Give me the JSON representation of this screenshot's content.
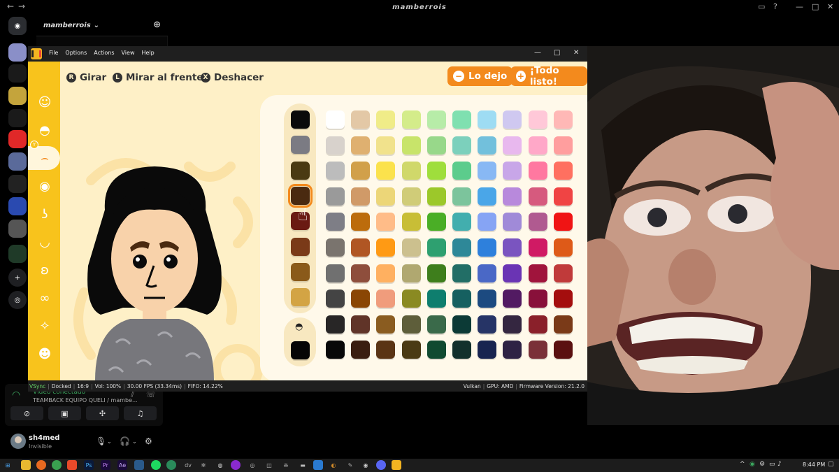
{
  "discord": {
    "window_title": "mamberrois",
    "server_name": "mamberrois",
    "voice": {
      "status": "Vídeo conectado",
      "channel": "TEAMBACK EQUIPO QUELI / mambe..."
    },
    "user": {
      "name": "sh4med",
      "status": "Invisible"
    }
  },
  "emulator": {
    "menu": [
      "File",
      "Options",
      "Actions",
      "View",
      "Help"
    ],
    "status": {
      "vsync": "VSync",
      "docked": "Docked",
      "aspect": "16:9",
      "vol": "Vol: 100%",
      "fps": "30.00 FPS (33.34ms)",
      "fifo": "FIFO: 14.22%",
      "api": "Vulkan",
      "gpu": "GPU: AMD",
      "firmware": "Firmware Version: 21.2.0"
    }
  },
  "game": {
    "rotate": "Girar",
    "face_front": "Mirar al frente",
    "undo": "Deshacer",
    "quit": "Lo dejo",
    "done": "¡Todo listo!",
    "rotate_glyph": "R",
    "face_glyph": "L",
    "undo_glyph": "X",
    "badge": "Y"
  },
  "palette": {
    "primary": [
      "#0a0a0a",
      "#7b7b83",
      "#4a3a12",
      "#4a2a10",
      "#6a1a12",
      "#7a3a18",
      "#8a5a1a",
      "#d3a444"
    ],
    "selected_index": 3,
    "hair_primary": "#050505",
    "rows": [
      [
        "#ffffff",
        "#e3c8a6",
        "#f0ec88",
        "#d4ec8a",
        "#b7eca8",
        "#7fe0b0",
        "#9edcf3",
        "#cfc8f0",
        "#ffc8d8",
        "#ffb8b6"
      ],
      [
        "#d8d2cc",
        "#dfb070",
        "#f1e28c",
        "#c8e46a",
        "#98d88a",
        "#7cd0bc",
        "#72c0dc",
        "#e8b8ee",
        "#ffa8c8",
        "#ff9e9e"
      ],
      [
        "#bcbcbc",
        "#d1a04a",
        "#fbe24c",
        "#d0d86a",
        "#9fde3c",
        "#5ccc8c",
        "#88b8f4",
        "#c8a6e8",
        "#ff78a0",
        "#ff7060"
      ],
      [
        "#9a9a9a",
        "#d09a68",
        "#ecd678",
        "#d0cc78",
        "#9cc82a",
        "#7cc49c",
        "#4aa6e8",
        "#b889dc",
        "#d65a7e",
        "#f04444"
      ],
      [
        "#7e7e86",
        "#bc6c0c",
        "#ffbc88",
        "#c8be36",
        "#4aae26",
        "#42aeae",
        "#86a4f4",
        "#a08ad8",
        "#b05a90",
        "#f01414"
      ],
      [
        "#7a746e",
        "#b05624",
        "#ff9a14",
        "#ccc08e",
        "#2ea070",
        "#2e8898",
        "#2e80dc",
        "#7a54c0",
        "#d01a64",
        "#de5a18"
      ],
      [
        "#707070",
        "#8e4e3c",
        "#ffb060",
        "#b0a870",
        "#3e7e1c",
        "#226e66",
        "#4a68c6",
        "#6a34b4",
        "#a0143c",
        "#c03a3a"
      ],
      [
        "#444444",
        "#8a4604",
        "#f09c7c",
        "#8a8a22",
        "#0e7e6e",
        "#166060",
        "#1c4a80",
        "#521a62",
        "#88103a",
        "#a40e0e"
      ],
      [
        "#282626",
        "#603428",
        "#8a5c20",
        "#5e5e3a",
        "#3a6a4a",
        "#0c3a36",
        "#263466",
        "#342640",
        "#8a202a",
        "#7a3a18"
      ],
      [
        "#080808",
        "#3a1e10",
        "#5a3414",
        "#4a3a14",
        "#104a30",
        "#12302c",
        "#182450",
        "#2e2244",
        "#7a3038",
        "#5a1010"
      ]
    ]
  }
}
